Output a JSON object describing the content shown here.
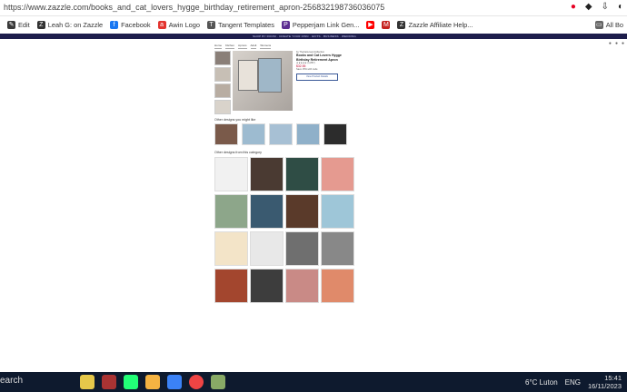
{
  "browser": {
    "url": "https://www.zazzle.com/books_and_cat_lovers_hygge_birthday_retirement_apron-256832198736036075",
    "bookmarks": [
      {
        "label": "Edit",
        "icon": "pencil-icon",
        "color": "#3a3a3a"
      },
      {
        "label": "Leah G: on Zazzle",
        "icon": "zazzle-icon",
        "color": "#333"
      },
      {
        "label": "Facebook",
        "icon": "facebook-icon",
        "color": "#1877f2"
      },
      {
        "label": "Awin Logo",
        "icon": "awin-icon",
        "color": "#e3342f"
      },
      {
        "label": "Tangent Templates",
        "icon": "tangent-icon",
        "color": "#555"
      },
      {
        "label": "Pepperjam Link Gen...",
        "icon": "pepperjam-icon",
        "color": "#5c2d91"
      },
      {
        "label": "Zazzle Affiliate Help...",
        "icon": "zazzle-icon",
        "color": "#333"
      },
      {
        "label": "All Bo",
        "icon": "folder-icon",
        "color": "#666"
      }
    ]
  },
  "site": {
    "nav_text": "SHOP BY ROOM  ·  CREATE YOUR OWN  ·  GIFTS  ·  BUSINESS  ·  WEDDING"
  },
  "product": {
    "subnav": [
      "Home",
      "Kitchen",
      "Aprons",
      "Adult",
      "Womens"
    ],
    "breadcrumb": "by TheCatLoversCollection",
    "title": "Books and Cat Lovers Hygge Birthday Retirement Apron",
    "rating": "★★★★★ (1,857)",
    "price": "$32.55",
    "price_note": "Save 15% with code",
    "button": "View Product Details"
  },
  "sections": {
    "also_like": "Other designs you might like",
    "same_cat": "Other designs from this category"
  },
  "colors": {
    "accent": "#c1002b",
    "nav": "#1d1d4b",
    "taskbar": "#0e1a2e"
  },
  "taskbar": {
    "search": "earch",
    "weather": "6°C  Luton",
    "lang": "ENG",
    "time": "15:41",
    "date": "16/11/2023"
  }
}
